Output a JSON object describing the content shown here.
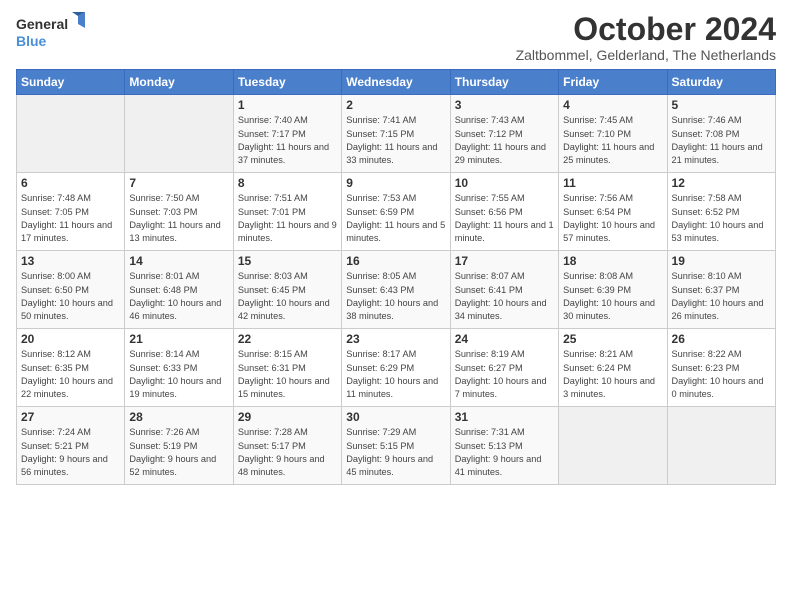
{
  "header": {
    "logo_line1": "General",
    "logo_line2": "Blue",
    "title": "October 2024",
    "subtitle": "Zaltbommel, Gelderland, The Netherlands"
  },
  "weekdays": [
    "Sunday",
    "Monday",
    "Tuesday",
    "Wednesday",
    "Thursday",
    "Friday",
    "Saturday"
  ],
  "weeks": [
    [
      {
        "day": "",
        "info": ""
      },
      {
        "day": "",
        "info": ""
      },
      {
        "day": "1",
        "info": "Sunrise: 7:40 AM\nSunset: 7:17 PM\nDaylight: 11 hours and 37 minutes."
      },
      {
        "day": "2",
        "info": "Sunrise: 7:41 AM\nSunset: 7:15 PM\nDaylight: 11 hours and 33 minutes."
      },
      {
        "day": "3",
        "info": "Sunrise: 7:43 AM\nSunset: 7:12 PM\nDaylight: 11 hours and 29 minutes."
      },
      {
        "day": "4",
        "info": "Sunrise: 7:45 AM\nSunset: 7:10 PM\nDaylight: 11 hours and 25 minutes."
      },
      {
        "day": "5",
        "info": "Sunrise: 7:46 AM\nSunset: 7:08 PM\nDaylight: 11 hours and 21 minutes."
      }
    ],
    [
      {
        "day": "6",
        "info": "Sunrise: 7:48 AM\nSunset: 7:05 PM\nDaylight: 11 hours and 17 minutes."
      },
      {
        "day": "7",
        "info": "Sunrise: 7:50 AM\nSunset: 7:03 PM\nDaylight: 11 hours and 13 minutes."
      },
      {
        "day": "8",
        "info": "Sunrise: 7:51 AM\nSunset: 7:01 PM\nDaylight: 11 hours and 9 minutes."
      },
      {
        "day": "9",
        "info": "Sunrise: 7:53 AM\nSunset: 6:59 PM\nDaylight: 11 hours and 5 minutes."
      },
      {
        "day": "10",
        "info": "Sunrise: 7:55 AM\nSunset: 6:56 PM\nDaylight: 11 hours and 1 minute."
      },
      {
        "day": "11",
        "info": "Sunrise: 7:56 AM\nSunset: 6:54 PM\nDaylight: 10 hours and 57 minutes."
      },
      {
        "day": "12",
        "info": "Sunrise: 7:58 AM\nSunset: 6:52 PM\nDaylight: 10 hours and 53 minutes."
      }
    ],
    [
      {
        "day": "13",
        "info": "Sunrise: 8:00 AM\nSunset: 6:50 PM\nDaylight: 10 hours and 50 minutes."
      },
      {
        "day": "14",
        "info": "Sunrise: 8:01 AM\nSunset: 6:48 PM\nDaylight: 10 hours and 46 minutes."
      },
      {
        "day": "15",
        "info": "Sunrise: 8:03 AM\nSunset: 6:45 PM\nDaylight: 10 hours and 42 minutes."
      },
      {
        "day": "16",
        "info": "Sunrise: 8:05 AM\nSunset: 6:43 PM\nDaylight: 10 hours and 38 minutes."
      },
      {
        "day": "17",
        "info": "Sunrise: 8:07 AM\nSunset: 6:41 PM\nDaylight: 10 hours and 34 minutes."
      },
      {
        "day": "18",
        "info": "Sunrise: 8:08 AM\nSunset: 6:39 PM\nDaylight: 10 hours and 30 minutes."
      },
      {
        "day": "19",
        "info": "Sunrise: 8:10 AM\nSunset: 6:37 PM\nDaylight: 10 hours and 26 minutes."
      }
    ],
    [
      {
        "day": "20",
        "info": "Sunrise: 8:12 AM\nSunset: 6:35 PM\nDaylight: 10 hours and 22 minutes."
      },
      {
        "day": "21",
        "info": "Sunrise: 8:14 AM\nSunset: 6:33 PM\nDaylight: 10 hours and 19 minutes."
      },
      {
        "day": "22",
        "info": "Sunrise: 8:15 AM\nSunset: 6:31 PM\nDaylight: 10 hours and 15 minutes."
      },
      {
        "day": "23",
        "info": "Sunrise: 8:17 AM\nSunset: 6:29 PM\nDaylight: 10 hours and 11 minutes."
      },
      {
        "day": "24",
        "info": "Sunrise: 8:19 AM\nSunset: 6:27 PM\nDaylight: 10 hours and 7 minutes."
      },
      {
        "day": "25",
        "info": "Sunrise: 8:21 AM\nSunset: 6:24 PM\nDaylight: 10 hours and 3 minutes."
      },
      {
        "day": "26",
        "info": "Sunrise: 8:22 AM\nSunset: 6:23 PM\nDaylight: 10 hours and 0 minutes."
      }
    ],
    [
      {
        "day": "27",
        "info": "Sunrise: 7:24 AM\nSunset: 5:21 PM\nDaylight: 9 hours and 56 minutes."
      },
      {
        "day": "28",
        "info": "Sunrise: 7:26 AM\nSunset: 5:19 PM\nDaylight: 9 hours and 52 minutes."
      },
      {
        "day": "29",
        "info": "Sunrise: 7:28 AM\nSunset: 5:17 PM\nDaylight: 9 hours and 48 minutes."
      },
      {
        "day": "30",
        "info": "Sunrise: 7:29 AM\nSunset: 5:15 PM\nDaylight: 9 hours and 45 minutes."
      },
      {
        "day": "31",
        "info": "Sunrise: 7:31 AM\nSunset: 5:13 PM\nDaylight: 9 hours and 41 minutes."
      },
      {
        "day": "",
        "info": ""
      },
      {
        "day": "",
        "info": ""
      }
    ]
  ]
}
